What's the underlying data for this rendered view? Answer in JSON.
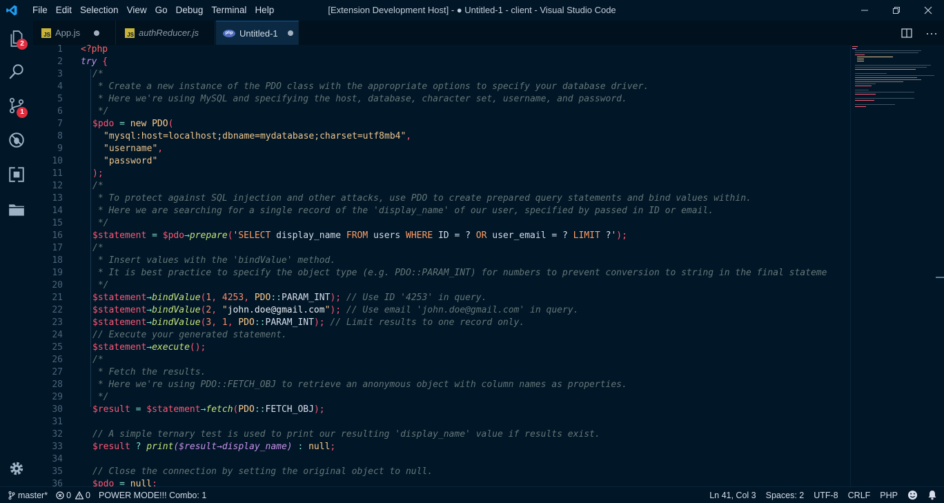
{
  "menu": [
    "File",
    "Edit",
    "Selection",
    "View",
    "Go",
    "Debug",
    "Terminal",
    "Help"
  ],
  "window_title": "[Extension Development Host] - ● Untitled-1 - client - Visual Studio Code",
  "activity": {
    "explorer_badge": "2",
    "scm_badge": "1"
  },
  "tabs": [
    {
      "label": "App.js",
      "icon": "js-icon",
      "dirty": true
    },
    {
      "label": "authReducer.js",
      "icon": "js-icon",
      "dirty": false
    },
    {
      "label": "Untitled-1",
      "icon": "php-icon",
      "dirty": true
    }
  ],
  "js_icon_text": "JS",
  "php_icon_text": "php",
  "line_numbers": [
    "1",
    "2",
    "3",
    "4",
    "5",
    "6",
    "7",
    "8",
    "9",
    "10",
    "11",
    "12",
    "13",
    "14",
    "15",
    "16",
    "17",
    "18",
    "19",
    "20",
    "21",
    "22",
    "23",
    "24",
    "25",
    "26",
    "27",
    "28",
    "29",
    "30",
    "31",
    "32",
    "33",
    "34",
    "35",
    "36"
  ],
  "code": {
    "l1": "<?php",
    "l2_kw": "try",
    "l2_rest": " {",
    "l3": "/*",
    "l4": " * Create a new instance of the PDO class with the appropriate options to specify your database driver.",
    "l5": " * Here we're using MySQL and specifying the host, database, character set, username, and password.",
    "l6": " */",
    "l7_var": "$pdo",
    "l7_eq": " = ",
    "l7_new": "new",
    "l7_cls": " PDO",
    "l7_paren": "(",
    "l8_str": "\"mysql:host=localhost;dbname=mydatabase;charset=utf8mb4\"",
    "l8_comma": ",",
    "l9_str": "\"username\"",
    "l9_comma": ",",
    "l10_str": "\"password\"",
    "l11": ");",
    "l12": "/*",
    "l13": " * To protect against SQL injection and other attacks, use PDO to create prepared query statements and bind values within.",
    "l14": " * Here we are searching for a single record of the 'display_name' of our user, specified by passed in ID or email.",
    "l15": " */",
    "l16_var": "$statement",
    "l16_eq": " = ",
    "l16_var2": "$pdo",
    "l16_arrow": "→",
    "l16_meth": "prepare",
    "l16_open": "(",
    "l16_q1": "'",
    "l16_sql": [
      {
        "t": "SELECT",
        "k": true
      },
      {
        "t": " display_name ",
        "k": false
      },
      {
        "t": "FROM",
        "k": true
      },
      {
        "t": " users ",
        "k": false
      },
      {
        "t": "WHERE",
        "k": true
      },
      {
        "t": " ID = ? ",
        "k": false
      },
      {
        "t": "OR",
        "k": true
      },
      {
        "t": " user_email = ? ",
        "k": false
      },
      {
        "t": "LIMIT",
        "k": true
      },
      {
        "t": " ?",
        "k": false
      }
    ],
    "l16_q2": "'",
    "l16_close": ");",
    "l17": "/*",
    "l18": " * Insert values with the 'bindValue' method.",
    "l19": " * It is best practice to specify the object type (e.g. PDO::PARAM_INT) for numbers to prevent conversion to string in the final stateme",
    "l20": " */",
    "l21": {
      "var": "$statement",
      "arrow": "→",
      "meth": "bindValue",
      "open": "(",
      "a1": "1",
      "c1": ", ",
      "a2": "4253",
      "c2": ", ",
      "cls": "PDO",
      "dc": "::",
      "const": "PARAM_INT",
      "close": ");",
      "cm": " // Use ID '4253' in query."
    },
    "l22": {
      "var": "$statement",
      "arrow": "→",
      "meth": "bindValue",
      "open": "(",
      "a1": "2",
      "c1": ", ",
      "q1": "\"",
      "str": "john.doe@gmail.com",
      "q2": "\"",
      "close": ");",
      "cm": " // Use email 'john.doe@gmail.com' in query."
    },
    "l23": {
      "var": "$statement",
      "arrow": "→",
      "meth": "bindValue",
      "open": "(",
      "a1": "3",
      "c1": ", ",
      "a2": "1",
      "c2": ", ",
      "cls": "PDO",
      "dc": "::",
      "const": "PARAM_INT",
      "close": ");",
      "cm": " // Limit results to one record only."
    },
    "l24": "// Execute your generated statement.",
    "l25": {
      "var": "$statement",
      "arrow": "→",
      "meth": "execute",
      "close": "();"
    },
    "l26": "/*",
    "l27": " * Fetch the results.",
    "l28": " * Here we're using PDO::FETCH_OBJ to retrieve an anonymous object with column names as properties.",
    "l29": " */",
    "l30": {
      "var": "$result",
      "eq": " = ",
      "var2": "$statement",
      "arrow": "→",
      "meth": "fetch",
      "open": "(",
      "cls": "PDO",
      "dc": "::",
      "const": "FETCH_OBJ",
      "close": ");"
    },
    "l32": "// A simple ternary test is used to print our resulting 'display_name' value if results exist.",
    "l33": {
      "var": "$result",
      "q": " ? ",
      "fn": "print",
      "open": "(",
      "var2": "$result",
      "arrow": "→",
      "prop": "display_name",
      "close": ")",
      "rest": " : ",
      "null": "null",
      "end": ";"
    },
    "l35": "// Close the connection by setting the original object to null.",
    "l36": {
      "var": "$pdo",
      "eq": " = ",
      "null": "null",
      "end": ";"
    }
  },
  "status": {
    "branch": "master*",
    "errors": "0",
    "warnings": "0",
    "power_mode": "POWER MODE!!! Combo: 1",
    "position": "Ln 41, Col 3",
    "spaces": "Spaces: 2",
    "encoding": "UTF-8",
    "eol": "CRLF",
    "language": "PHP"
  },
  "colors": {
    "background": "#011627",
    "comment": "#637777",
    "variable": "#ff5874",
    "string": "#ecc48d",
    "method": "#c5e478",
    "keyword": "#c792ea"
  }
}
